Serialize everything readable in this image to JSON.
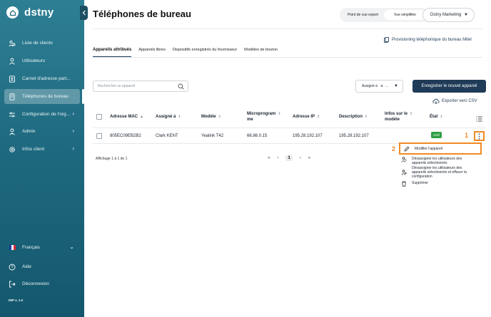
{
  "brand": {
    "name": "dstny",
    "version": "IMP v. 1.0"
  },
  "sidebar": {
    "items": [
      {
        "label": "Liste de clients",
        "icon": "clients-icon"
      },
      {
        "label": "Utilisateurs",
        "icon": "user-icon"
      },
      {
        "label": "Carnet d'adresse part...",
        "icon": "address-book-icon"
      },
      {
        "label": "Téléphones de bureau",
        "icon": "desk-phone-icon"
      },
      {
        "label": "Configuration de l'org...",
        "icon": "sliders-icon"
      },
      {
        "label": "Admin",
        "icon": "admin-icon"
      },
      {
        "label": "Infos client",
        "icon": "gear-icon"
      }
    ],
    "language": "Français",
    "help": "Aide",
    "logout": "Déconnexion"
  },
  "header": {
    "title": "Téléphones de bureau",
    "view_expert": "Point de vue expert",
    "view_simple": "Vue simplifiée",
    "company": "Dstny Marketing",
    "provisioning_link": "Provisioning téléphonique du bureau Mitel"
  },
  "tabs": [
    {
      "label": "Appareils attribués"
    },
    {
      "label": "Appareils libres"
    },
    {
      "label": "Dispositifs enregistrés du fournisseur"
    },
    {
      "label": "Modèles de bouton"
    }
  ],
  "toolbar": {
    "search_placeholder": "Rechercher un appareil",
    "assign_filter": "Assigné à",
    "assign_filter_suffix": "...",
    "register_button": "Enregistrer le nouvel appareil",
    "export": "Exporter vers CSV"
  },
  "table": {
    "headers": {
      "mac": "Adresse MAC",
      "assigned": "Assigné à",
      "model": "Modèle",
      "firmware_1": "Microprogram",
      "firmware_2": "me",
      "ip": "Adresse IP",
      "description": "Description",
      "model_info_1": "Infos sur le",
      "model_info_2": "modèle",
      "state": "État"
    },
    "row": {
      "mac": "805EC09EB2B2",
      "assigned": "Clark KENT",
      "model": "Yealink T42",
      "firmware": "66.86.0.15",
      "ip": "195.28.192.107",
      "description": "195.28.192.107",
      "state": "Actif"
    },
    "showing": "Affichage 1 à 1 de 1",
    "pager": {
      "first": "«",
      "prev": "‹",
      "page": "1",
      "next": "›",
      "last": "»"
    }
  },
  "annotations": {
    "step1": "1",
    "step2": "2"
  },
  "context_menu": {
    "edit": "Modifier l'appareil",
    "unassign_1": "Désassigner les utilisateurs des",
    "unassign_2": "appareils sélectionnés",
    "unassign_clear_1": "Désassigner les utilisateurs des",
    "unassign_clear_2": "appareils sélectionnés et effacer la",
    "unassign_clear_3": "configuration",
    "delete": "Supprimer"
  },
  "colors": {
    "sidebar": "#1f6a80",
    "primary": "#1f3b57",
    "highlight": "#f08a24",
    "active_badge": "#2f9e44"
  }
}
